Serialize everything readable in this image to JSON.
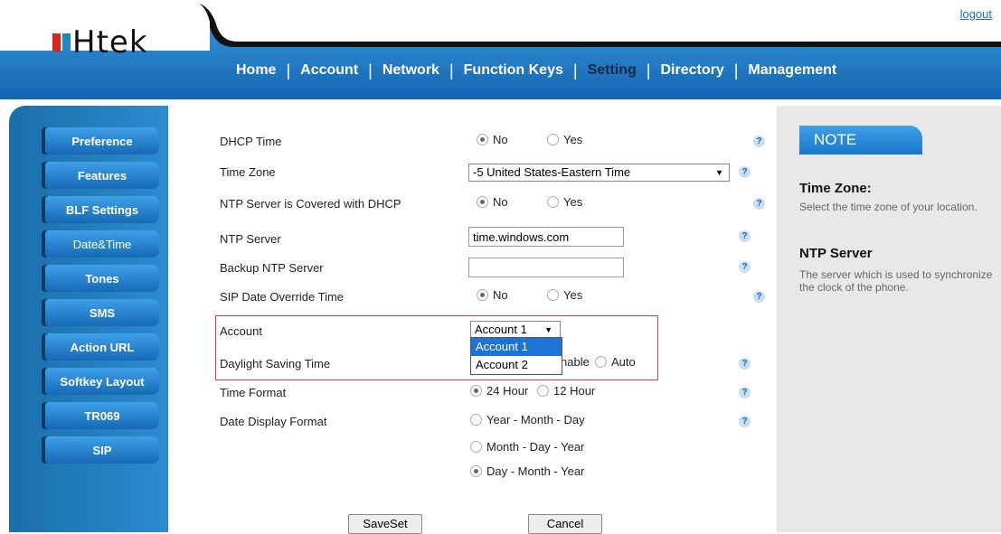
{
  "header": {
    "logo_text": "Htek",
    "logout_label": "logout",
    "nav": [
      "Home",
      "Account",
      "Network",
      "Function Keys",
      "Setting",
      "Directory",
      "Management"
    ],
    "active_nav": "Setting",
    "colors": {
      "brand_blue": "#1e88c8",
      "brand_red": "#d9261c"
    }
  },
  "sidebar": {
    "items": [
      "Preference",
      "Features",
      "BLF Settings",
      "Date&Time",
      "Tones",
      "SMS",
      "Action URL",
      "Softkey Layout",
      "TR069",
      "SIP"
    ],
    "active": "Date&Time"
  },
  "form": {
    "dhcp_time": {
      "label": "DHCP Time",
      "options": [
        "No",
        "Yes"
      ],
      "selected": "No"
    },
    "time_zone": {
      "label": "Time Zone",
      "value": "-5 United States-Eastern Time"
    },
    "ntp_covered": {
      "label": "NTP Server is Covered with DHCP",
      "options": [
        "No",
        "Yes"
      ],
      "selected": "No"
    },
    "ntp_server": {
      "label": "NTP Server",
      "value": "time.windows.com"
    },
    "backup_ntp": {
      "label": "Backup NTP Server",
      "value": ""
    },
    "sip_override": {
      "label": "SIP Date Override Time",
      "options": [
        "No",
        "Yes"
      ],
      "selected": "No"
    },
    "account": {
      "label": "Account",
      "value": "Account 1",
      "dropdown_options": [
        "Account 1",
        "Account 2"
      ],
      "highlighted": "Account 1"
    },
    "dst": {
      "label": "Daylight Saving Time",
      "visible_options": [
        "nable",
        "Auto"
      ]
    },
    "time_format": {
      "label": "Time Format",
      "options": [
        "24 Hour",
        "12 Hour"
      ],
      "selected": "24 Hour"
    },
    "date_format": {
      "label": "Date Display Format",
      "options": [
        "Year - Month - Day",
        "Month - Day - Year",
        "Day - Month - Year"
      ],
      "selected": "Day - Month - Year"
    },
    "save_label": "SaveSet",
    "cancel_label": "Cancel",
    "help_glyph": "?"
  },
  "note": {
    "tab": "NOTE",
    "sections": [
      {
        "title": "Time Zone:",
        "text": "Select the time zone of your location."
      },
      {
        "title": "NTP Server",
        "text": "The server which is used to synchronize the clock of the phone."
      }
    ]
  }
}
